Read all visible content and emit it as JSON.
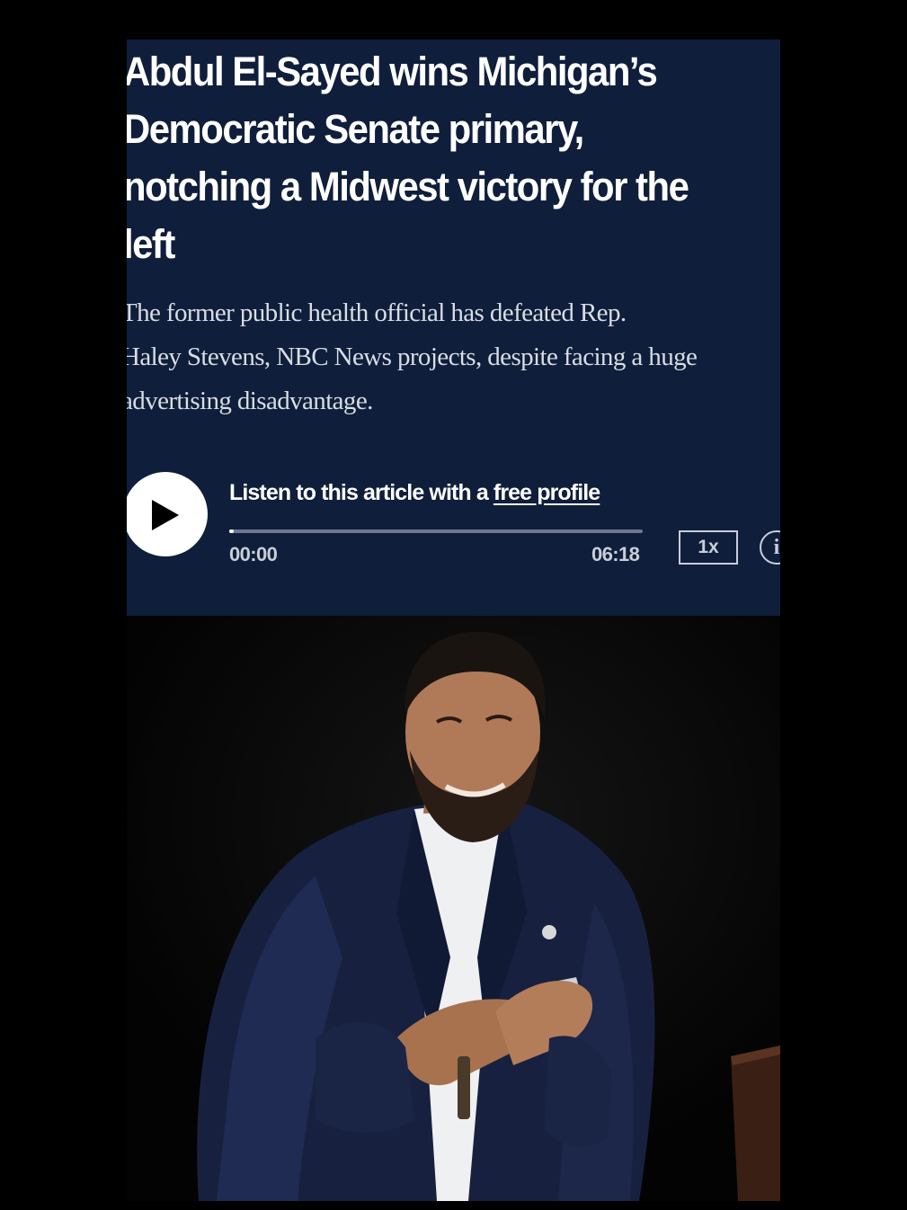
{
  "article": {
    "headline": "Abdul El-Sayed wins Michigan’s Democratic Senate primary, notching a Midwest victory for the left",
    "dek_lines": [
      "The former public health official has defeated Rep.",
      "Haley Stevens, NBC News projects, despite facing a huge",
      "advertising disadvantage."
    ]
  },
  "player": {
    "listen_prefix": "Listen to this article with a ",
    "listen_link": "free profile",
    "current_time": "00:00",
    "duration": "06:18",
    "speed": "1x",
    "info_glyph": "i",
    "progress": 0.01,
    "play_icon": "play-icon",
    "info_icon": "info-icon"
  },
  "colors": {
    "panel_bg": "#0f1e3b",
    "background": "#000000",
    "text": "#ffffff",
    "muted": "#c9ced8"
  }
}
